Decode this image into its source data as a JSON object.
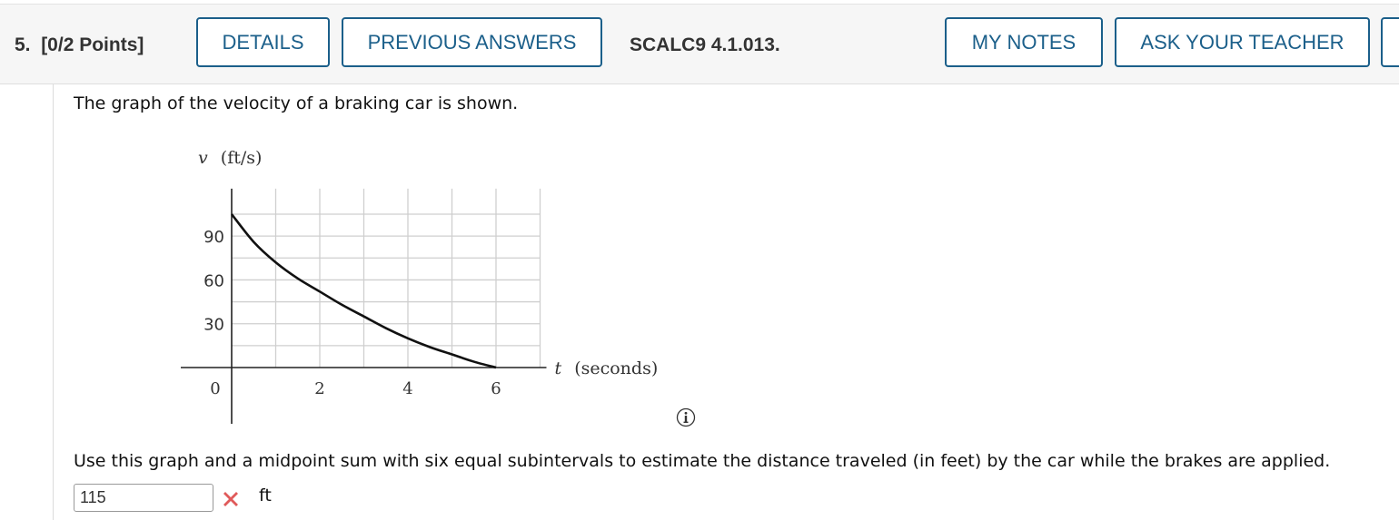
{
  "header": {
    "question_number": "5.",
    "points": "[0/2 Points]",
    "buttons": {
      "details": "DETAILS",
      "previous_answers": "PREVIOUS ANSWERS",
      "my_notes": "MY NOTES",
      "ask_teacher": "ASK YOUR TEACHER"
    },
    "problem_code": "SCALC9 4.1.013."
  },
  "question": {
    "intro": "The graph of the velocity of a braking car is shown.",
    "prompt": "Use this graph and a midpoint sum with six equal subintervals to estimate the distance traveled (in feet) by the car while the brakes are applied.",
    "answer_value": "115",
    "answer_status": "incorrect",
    "unit": "ft"
  },
  "icons": {
    "incorrect": "x-mark-icon",
    "info": "info-icon"
  },
  "colors": {
    "accent": "#1b5f8a",
    "incorrect": "#e05a5a"
  },
  "chart_data": {
    "type": "line",
    "title": "",
    "ylabel_var": "v",
    "ylabel_unit": "(ft/s)",
    "xlabel_var": "t",
    "xlabel_unit": "(seconds)",
    "xlim": [
      0,
      7
    ],
    "ylim": [
      0,
      120
    ],
    "x_ticks": [
      0,
      2,
      4,
      6
    ],
    "x_tick_labels": [
      "0",
      "2",
      "4",
      "6"
    ],
    "y_ticks": [
      30,
      60,
      90
    ],
    "y_tick_labels": [
      "30",
      "60",
      "90"
    ],
    "x_grid_step": 1,
    "y_grid_step": 15,
    "grid": true,
    "series": [
      {
        "name": "velocity",
        "x": [
          0,
          0.5,
          1,
          1.5,
          2,
          2.5,
          3,
          3.5,
          4,
          4.5,
          5,
          5.5,
          6
        ],
        "y": [
          105,
          86,
          72,
          61,
          52,
          43,
          35,
          27,
          20,
          14,
          9,
          4,
          0
        ]
      }
    ]
  }
}
